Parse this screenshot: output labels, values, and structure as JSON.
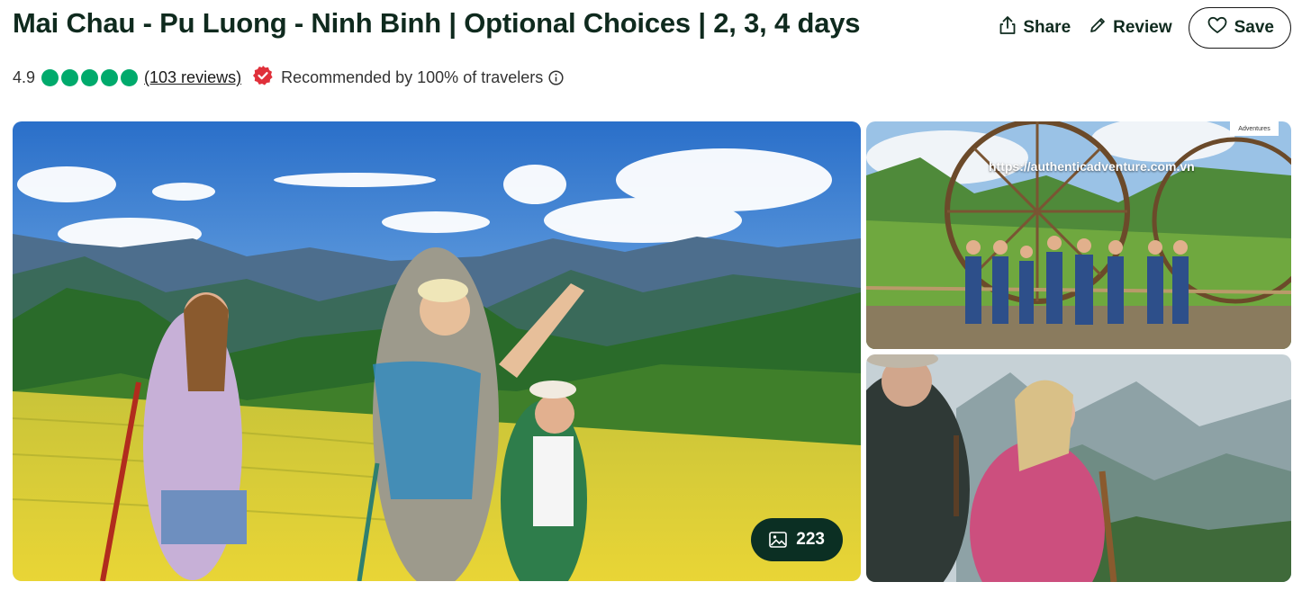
{
  "header": {
    "title": "Mai Chau - Pu Luong - Ninh Binh | Optional Choices | 2, 3, 4 days",
    "share_label": "Share",
    "review_label": "Review",
    "save_label": "Save"
  },
  "rating": {
    "score": "4.9",
    "bubbles_filled": 5,
    "reviews_link": "(103 reviews)",
    "recommended_text": "Recommended by 100% of travelers",
    "bubble_color": "#00aa6c",
    "badge_color": "#e0303a"
  },
  "gallery": {
    "photo_count": "223",
    "watermark_text": "https://authenticadventure.com.vn",
    "logo_text": "Adventures"
  },
  "icons": {
    "share": "share-icon",
    "review": "pencil-icon",
    "save": "heart-icon",
    "badge": "verified-badge-icon",
    "info": "info-icon",
    "photos": "image-icon"
  }
}
